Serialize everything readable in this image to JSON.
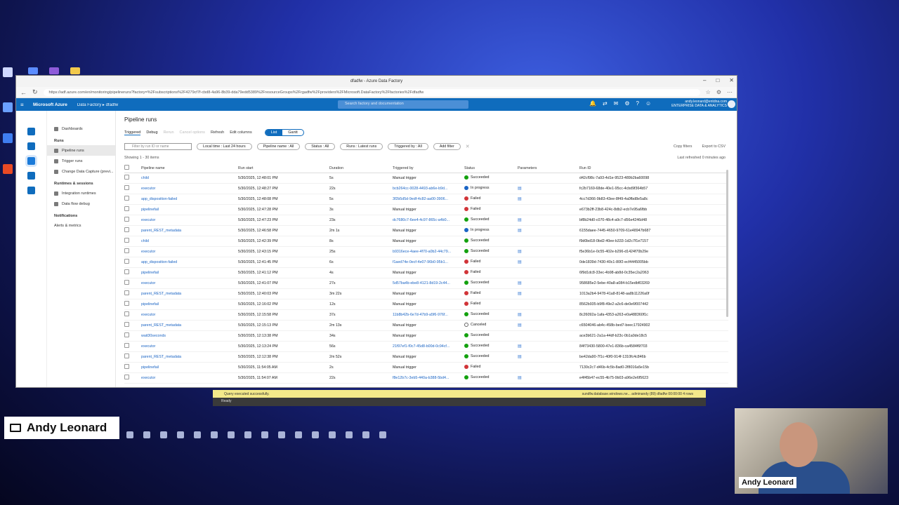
{
  "desktop": {
    "presenter_name": "Andy Leonard",
    "webcam_name": "Andy Leonard"
  },
  "browser": {
    "title": "dfadfw - Azure Data Factory",
    "url": "https://adf.azure.com/en/monitoring/pipelineruns?factory=%2Fsubscriptions%2F4279cf7f-cbd8-4a96-8b39-dda79edd5389%2FresourceGroups%2Frgadfw%2Fproviders%2FMicrosoft.DataFactory%2Ffactories%2Fdfadfw"
  },
  "header": {
    "brand": "Microsoft Azure",
    "breadcrumb": "Data Factory  ▸  dfadfw",
    "search_placeholder": "Search factory and documentation",
    "user_email": "andy.leonard@entdna.com",
    "user_org": "ENTERPRISE DATA & ANALYTICS"
  },
  "sidenav": {
    "dashboards": "Dashboards",
    "runs_section": "Runs",
    "pipeline_runs": "Pipeline runs",
    "trigger_runs": "Trigger runs",
    "cdc": "Change Data Capture (previ...",
    "runtimes_section": "Runtimes & sessions",
    "integration_runtimes": "Integration runtimes",
    "data_flow_debug": "Data flow debug",
    "notifications_section": "Notifications",
    "alerts": "Alerts & metrics"
  },
  "main": {
    "title": "Pipeline runs",
    "tab_triggered": "Triggered",
    "tab_debug": "Debug",
    "rerun": "Rerun",
    "cancel": "Cancel options",
    "refresh": "Refresh",
    "edit_columns": "Edit columns",
    "view_list": "List",
    "view_gantt": "Gantt",
    "filter_placeholder": "Filter by run ID or name",
    "local_time": "Local time : Last 24 hours",
    "pipeline_name_filter": "Pipeline name : All",
    "status_filter": "Status : All",
    "runs_filter": "Runs : Latest runs",
    "triggered_by_filter": "Triggered by : All",
    "add_filter": "Add filter",
    "copy_filters": "Copy filters",
    "export_csv": "Export to CSV",
    "showing": "Showing 1 - 30 items",
    "last_refreshed": "Last refreshed 0 minutes ago"
  },
  "table": {
    "headers": [
      "Pipeline name",
      "Run start",
      "Duration",
      "Triggered by",
      "Status",
      "Parameters",
      "Run ID"
    ],
    "rows": [
      {
        "name": "child",
        "start": "5/30/2025, 12:48:01 PM",
        "duration": "5s",
        "trigger": "Manual trigger",
        "trigger_link": false,
        "status": "Succeeded",
        "kind": "ok",
        "params": false,
        "run_id": "d42cf98c-7a93-4d1e-9523-489b2ba60098"
      },
      {
        "name": "executor",
        "start": "5/30/2025, 12:48:27 PM",
        "duration": "22s",
        "trigger": "bcb264cc-0028-4493-ab6e-b9d...",
        "trigger_link": true,
        "status": "In progress",
        "kind": "prog",
        "params": true,
        "run_id": "fc2b7169-68de-40e1-95cc-4cbd9f364b57"
      },
      {
        "name": "app_disposition-failed",
        "start": "5/30/2025, 12:48:08 PM",
        "duration": "5s",
        "trigger": "3f2b5d5d-9edf-4c82-aa00-3906...",
        "trigger_link": true,
        "status": "Failed",
        "kind": "fail",
        "params": true,
        "run_id": "4cc7d366-9b83-43ee-8f49-4a0fbd8e5a8c"
      },
      {
        "name": "pipelinefail",
        "start": "5/30/2025, 12:47:28 PM",
        "duration": "3s",
        "trigger": "Manual trigger",
        "trigger_link": false,
        "status": "Failed",
        "kind": "fail",
        "params": false,
        "run_id": "e673b2ff-23b8-424c-8db2-ecb7e95a6fbb"
      },
      {
        "name": "executor",
        "start": "5/30/2025, 12:47:23 PM",
        "duration": "23s",
        "trigger": "dc7680c7-6ee4-4c97-865c-a4b0...",
        "trigger_link": true,
        "status": "Succeeded",
        "kind": "ok",
        "params": true,
        "run_id": "bf8b24d0-c070-48c4-a9c7-d56e4246d48"
      },
      {
        "name": "parent_REST_metadata",
        "start": "5/30/2025, 12:46:58 PM",
        "duration": "2m 1s",
        "trigger": "Manual trigger",
        "trigger_link": false,
        "status": "In progress",
        "kind": "prog",
        "params": true,
        "run_id": "6155daee-7445-4650-9709-61e48947b687"
      },
      {
        "name": "child",
        "start": "5/30/2025, 12:42:39 PM",
        "duration": "8s",
        "trigger": "Manual trigger",
        "trigger_link": false,
        "status": "Succeeded",
        "kind": "ok",
        "params": false,
        "run_id": "f9d0bd18-0bd2-40ee-b333-1d2c7f1e7157"
      },
      {
        "name": "executor",
        "start": "5/30/2025, 12:43:15 PM",
        "duration": "25s",
        "trigger": "b9316ece-4aee-4f70-a0b2-44c79...",
        "trigger_link": true,
        "status": "Succeeded",
        "kind": "ok",
        "params": true,
        "run_id": "f5e36b1e-0c55-402e-b296-d1424f70b29e"
      },
      {
        "name": "app_disposition-failed",
        "start": "5/30/2025, 12:41:45 PM",
        "duration": "6s",
        "trigger": "f1aed74e-0ecf-4e07-96b0-95b1...",
        "trigger_link": true,
        "status": "Failed",
        "kind": "fail",
        "params": true,
        "run_id": "0de1839d-7430-40c1-80f2-ecf4445005bb"
      },
      {
        "name": "pipelinefail",
        "start": "5/30/2025, 12:41:12 PM",
        "duration": "4s",
        "trigger": "Manual trigger",
        "trigger_link": false,
        "status": "Failed",
        "kind": "fail",
        "params": false,
        "run_id": "6f9d1dc8-33ec-4b98-ab8d-0c35ec2a2063"
      },
      {
        "name": "executor",
        "start": "5/30/2025, 12:41:07 PM",
        "duration": "27s",
        "trigger": "5d57ba4b-ebe8-4121-8d19-2c44...",
        "trigger_link": true,
        "status": "Succeeded",
        "kind": "ok",
        "params": true,
        "run_id": "958685e2-5ebe-40a8-a084-b15edbf03269"
      },
      {
        "name": "parent_REST_metadata",
        "start": "5/30/2025, 12:40:03 PM",
        "duration": "3m 22s",
        "trigger": "Manual trigger",
        "trigger_link": false,
        "status": "Failed",
        "kind": "fail",
        "params": true,
        "run_id": "1013a2b4-9478-41a8-8148-aa8b11226a0f"
      },
      {
        "name": "pipelinefail",
        "start": "5/30/2025, 12:16:02 PM",
        "duration": "12s",
        "trigger": "Manual trigger",
        "trigger_link": false,
        "status": "Failed",
        "kind": "fail",
        "params": false,
        "run_id": "8562b935-b9f8-49e2-a3c6-de0e6f007442"
      },
      {
        "name": "executor",
        "start": "5/30/2025, 12:15:58 PM",
        "duration": "37s",
        "trigger": "11b8b42b-6e7d-47b9-a5f6-976f...",
        "trigger_link": true,
        "status": "Succeeded",
        "kind": "ok",
        "params": true,
        "run_id": "8c26092a-1afa-4353-a263-e0a488360f1c"
      },
      {
        "name": "parent_REST_metadata",
        "start": "5/30/2025, 12:15:13 PM",
        "duration": "2m 13s",
        "trigger": "Manual trigger",
        "trigger_link": false,
        "status": "Canceled",
        "kind": "cancel",
        "params": true,
        "run_id": "c6504046-ab4c-458b-bed7-beec17924902"
      },
      {
        "name": "wait30seconds",
        "start": "5/30/2025, 12:13:38 PM",
        "duration": "34s",
        "trigger": "Manual trigger",
        "trigger_link": false,
        "status": "Succeeded",
        "kind": "ok",
        "params": false,
        "run_id": "ace3b621-2a1a-44df-b23c-0b1a0de18c5"
      },
      {
        "name": "executor",
        "start": "5/30/2025, 12:13:24 PM",
        "duration": "56s",
        "trigger": "21f97ef1-f0c7-45d8-b00d-0c94cf...",
        "trigger_link": true,
        "status": "Succeeded",
        "kind": "ok",
        "params": true,
        "run_id": "84f73430-5800-47e1-836b-ca4584f6f703"
      },
      {
        "name": "parent_REST_metadata",
        "start": "5/30/2025, 12:12:38 PM",
        "duration": "2m 52s",
        "trigger": "Manual trigger",
        "trigger_link": false,
        "status": "Succeeded",
        "kind": "ok",
        "params": true,
        "run_id": "be42da90-7f1c-40f0-914f-1310fc4c846b"
      },
      {
        "name": "pipelinefail",
        "start": "5/30/2025, 11:54:05 AM",
        "duration": "2s",
        "trigger": "Manual trigger",
        "trigger_link": false,
        "status": "Failed",
        "kind": "fail",
        "params": false,
        "run_id": "7130c2c7-d46b-4c5b-8ad0-2f8016a5e15b"
      },
      {
        "name": "executor",
        "start": "5/30/2025, 11:54:07 AM",
        "duration": "22s",
        "trigger": "f8e12b7c-3eb5-440a-b388-5bd4...",
        "trigger_link": true,
        "status": "Succeeded",
        "kind": "ok",
        "params": true,
        "run_id": "e4f45b47-ec55-4b75-9b03-a96e2e6f5623"
      }
    ]
  },
  "statusbar": {
    "query_ok": "Query executed successfully.",
    "server": "sundfw.database.windows.ne...   adminandy (89)   dfadfw   00:00:00   4 rows",
    "ready": "Ready"
  }
}
